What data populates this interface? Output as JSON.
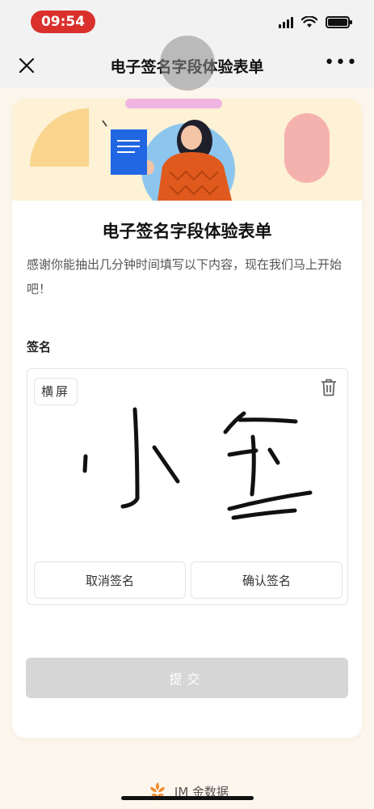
{
  "status_bar": {
    "time": "09:54"
  },
  "nav": {
    "title": "电子签名字段体验表单"
  },
  "form": {
    "title": "电子签名字段体验表单",
    "description": "感谢你能抽出几分钟时间填写以下内容，现在我们马上开始吧！",
    "field_label": "签名",
    "landscape_button": "横屏",
    "cancel_sign": "取消签名",
    "confirm_sign": "确认签名",
    "submit": "提交"
  },
  "footer": {
    "brand": "IM 金数据"
  },
  "colors": {
    "time_pill": "#d9302c",
    "banner_bg": "#fdf1d6",
    "submit_disabled": "#d6d6d6"
  },
  "icons": [
    "close-icon",
    "more-icon",
    "trash-icon",
    "brand-logo-icon"
  ]
}
